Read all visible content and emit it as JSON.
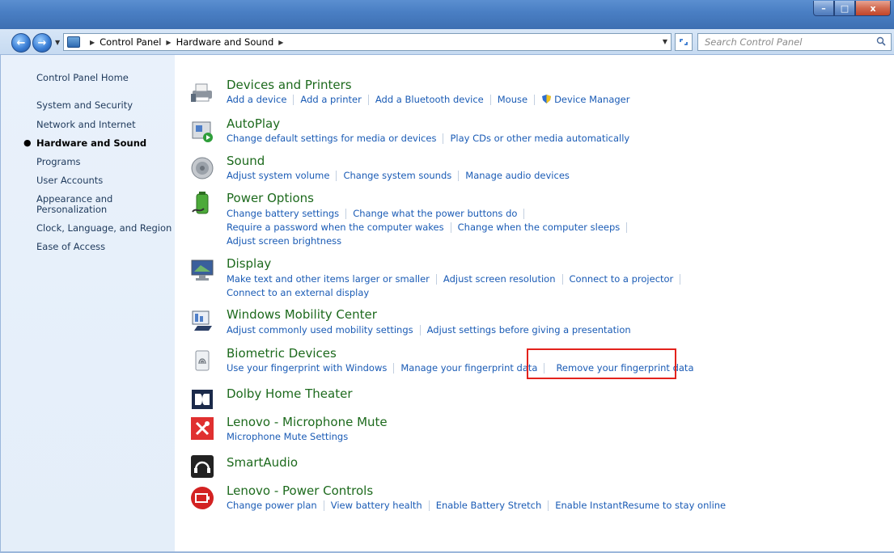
{
  "window": {
    "minimize_glyph": "–",
    "maximize_glyph": "□",
    "close_glyph": "x"
  },
  "address": {
    "back_glyph": "←",
    "forward_glyph": "→",
    "crumbs": [
      "Control Panel",
      "Hardware and Sound"
    ],
    "search_placeholder": "Search Control Panel"
  },
  "sidebar": {
    "items": [
      {
        "label": "Control Panel Home"
      },
      {
        "label": "System and Security"
      },
      {
        "label": "Network and Internet"
      },
      {
        "label": "Hardware and Sound",
        "active": true
      },
      {
        "label": "Programs"
      },
      {
        "label": "User Accounts"
      },
      {
        "label": "Appearance and"
      },
      {
        "label": "Personalization"
      },
      {
        "label": "Clock, Language, and Region"
      },
      {
        "label": "Ease of Access"
      }
    ]
  },
  "categories": [
    {
      "title": "Devices and Printers",
      "icon": "printer-icon",
      "links": [
        "Add a device",
        "Add a printer",
        "Add a Bluetooth device",
        "Mouse",
        "Device Manager"
      ]
    },
    {
      "title": "AutoPlay",
      "icon": "autoplay-icon",
      "links": [
        "Change default settings for media or devices",
        "Play CDs or other media automatically"
      ]
    },
    {
      "title": "Sound",
      "icon": "speaker-icon",
      "links": [
        "Adjust system volume",
        "Change system sounds",
        "Manage audio devices"
      ]
    },
    {
      "title": "Power Options",
      "icon": "power-options-icon",
      "links": [
        "Change battery settings",
        "Change what the power buttons do",
        "Require a password when the computer wakes",
        "Change when the computer sleeps",
        "Adjust screen brightness"
      ]
    },
    {
      "title": "Display",
      "icon": "display-icon",
      "links": [
        "Make text and other items larger or smaller",
        "Adjust screen resolution",
        "Connect to a projector",
        "Connect to an external display"
      ]
    },
    {
      "title": "Windows Mobility Center",
      "icon": "mobility-center-icon",
      "links": [
        "Adjust commonly used mobility settings",
        "Adjust settings before giving a presentation"
      ]
    },
    {
      "title": "Biometric Devices",
      "icon": "fingerprint-icon",
      "links": [
        "Use your fingerprint with Windows",
        "Manage your fingerprint data",
        "Remove your fingerprint data"
      ]
    },
    {
      "title": "Dolby Home Theater",
      "icon": "dolby-icon",
      "links": []
    },
    {
      "title": "Lenovo - Microphone Mute",
      "icon": "microphone-mute-icon",
      "links": [
        "Microphone Mute Settings"
      ]
    },
    {
      "title": "SmartAudio",
      "icon": "smartaudio-icon",
      "links": []
    },
    {
      "title": "Lenovo - Power Controls",
      "icon": "power-controls-icon",
      "links": [
        "Change power plan",
        "View battery health",
        "Enable Battery Stretch",
        "Enable InstantResume to stay online"
      ]
    }
  ],
  "colors": {
    "link": "#1a5bb5",
    "category_title": "#1d6a1d",
    "highlight": "#e3221c",
    "sidebar_bg": "#e9f1fb"
  }
}
